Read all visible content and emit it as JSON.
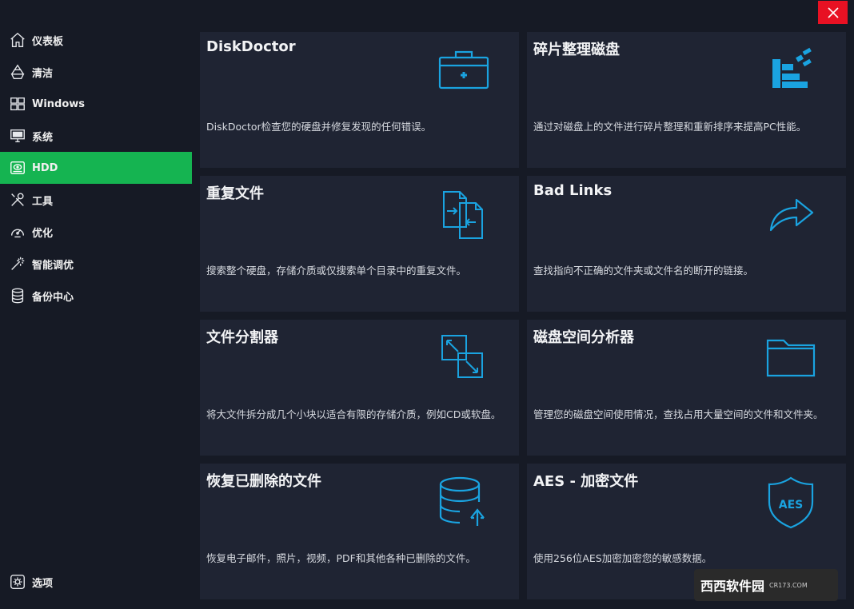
{
  "window": {
    "close_label": "×"
  },
  "sidebar": {
    "items": [
      {
        "label": "仪表板",
        "icon": "home-icon",
        "active": false
      },
      {
        "label": "清洁",
        "icon": "recycle-icon",
        "active": false
      },
      {
        "label": "Windows",
        "icon": "windows-icon",
        "active": false
      },
      {
        "label": "系统",
        "icon": "monitor-icon",
        "active": false
      },
      {
        "label": "HDD",
        "icon": "hdd-icon",
        "active": true
      },
      {
        "label": "工具",
        "icon": "tools-icon",
        "active": false
      },
      {
        "label": "优化",
        "icon": "gauge-icon",
        "active": false
      },
      {
        "label": "智能调优",
        "icon": "magic-wand-icon",
        "active": false
      },
      {
        "label": "备份中心",
        "icon": "database-icon",
        "active": false
      }
    ],
    "options_label": "选项"
  },
  "cards": [
    {
      "title": "DiskDoctor",
      "desc": "DiskDoctor检查您的硬盘并修复发现的任何错误。",
      "icon": "medkit-icon"
    },
    {
      "title": "碎片整理磁盘",
      "desc": "通过对磁盘上的文件进行碎片整理和重新排序来提高PC性能。",
      "icon": "defrag-icon"
    },
    {
      "title": "重复文件",
      "desc": "搜索整个硬盘，存储介质或仅搜索单个目录中的重复文件。",
      "icon": "duplicate-files-icon"
    },
    {
      "title": "Bad Links",
      "desc": "查找指向不正确的文件夹或文件名的断开的链接。",
      "icon": "share-arrow-icon"
    },
    {
      "title": "文件分割器",
      "desc": "将大文件拆分成几个小块以适合有限的存储介质，例如CD或软盘。",
      "icon": "file-split-icon"
    },
    {
      "title": "磁盘空间分析器",
      "desc": "管理您的磁盘空间使用情况，查找占用大量空间的文件和文件夹。",
      "icon": "folder-icon"
    },
    {
      "title": "恢复已删除的文件",
      "desc": "恢复电子邮件，照片，视频，PDF和其他各种已删除的文件。",
      "icon": "database-restore-icon"
    },
    {
      "title": "AES - 加密文件",
      "desc": "使用256位AES加密加密您的敏感数据。",
      "icon": "aes-shield-icon",
      "badge": "AES"
    }
  ],
  "watermark": {
    "text": "西西软件园",
    "sub": "CR173.COM"
  },
  "colors": {
    "accent": "#15b451",
    "icon_blue": "#1aa3e0",
    "card_bg": "#1f2433",
    "bg": "#161a25",
    "close": "#e81123"
  }
}
